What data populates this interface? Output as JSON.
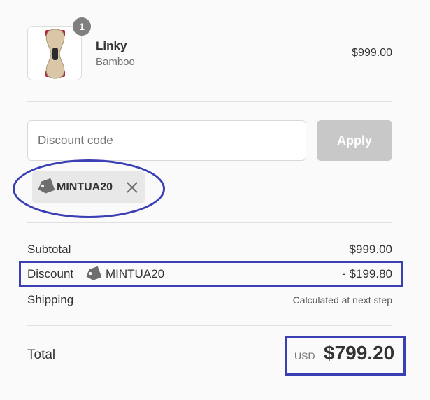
{
  "product": {
    "name": "Linky",
    "variant": "Bamboo",
    "price": "$999.00",
    "quantity": "1"
  },
  "discount_field": {
    "placeholder": "Discount code",
    "apply_label": "Apply"
  },
  "applied_code": {
    "code": "MINTUA20"
  },
  "summary": {
    "subtotal_label": "Subtotal",
    "subtotal_value": "$999.00",
    "discount_label": "Discount",
    "discount_code": "MINTUA20",
    "discount_value": "- $199.80",
    "shipping_label": "Shipping",
    "shipping_value": "Calculated at next step",
    "total_label": "Total",
    "currency": "USD",
    "total_value": "$799.20"
  },
  "icons": {
    "tag": "tag-icon",
    "remove": "close-icon"
  },
  "colors": {
    "annotation": "#3a3fb4",
    "apply_button": "#c8c8c8",
    "badge": "#7f7f7f"
  }
}
